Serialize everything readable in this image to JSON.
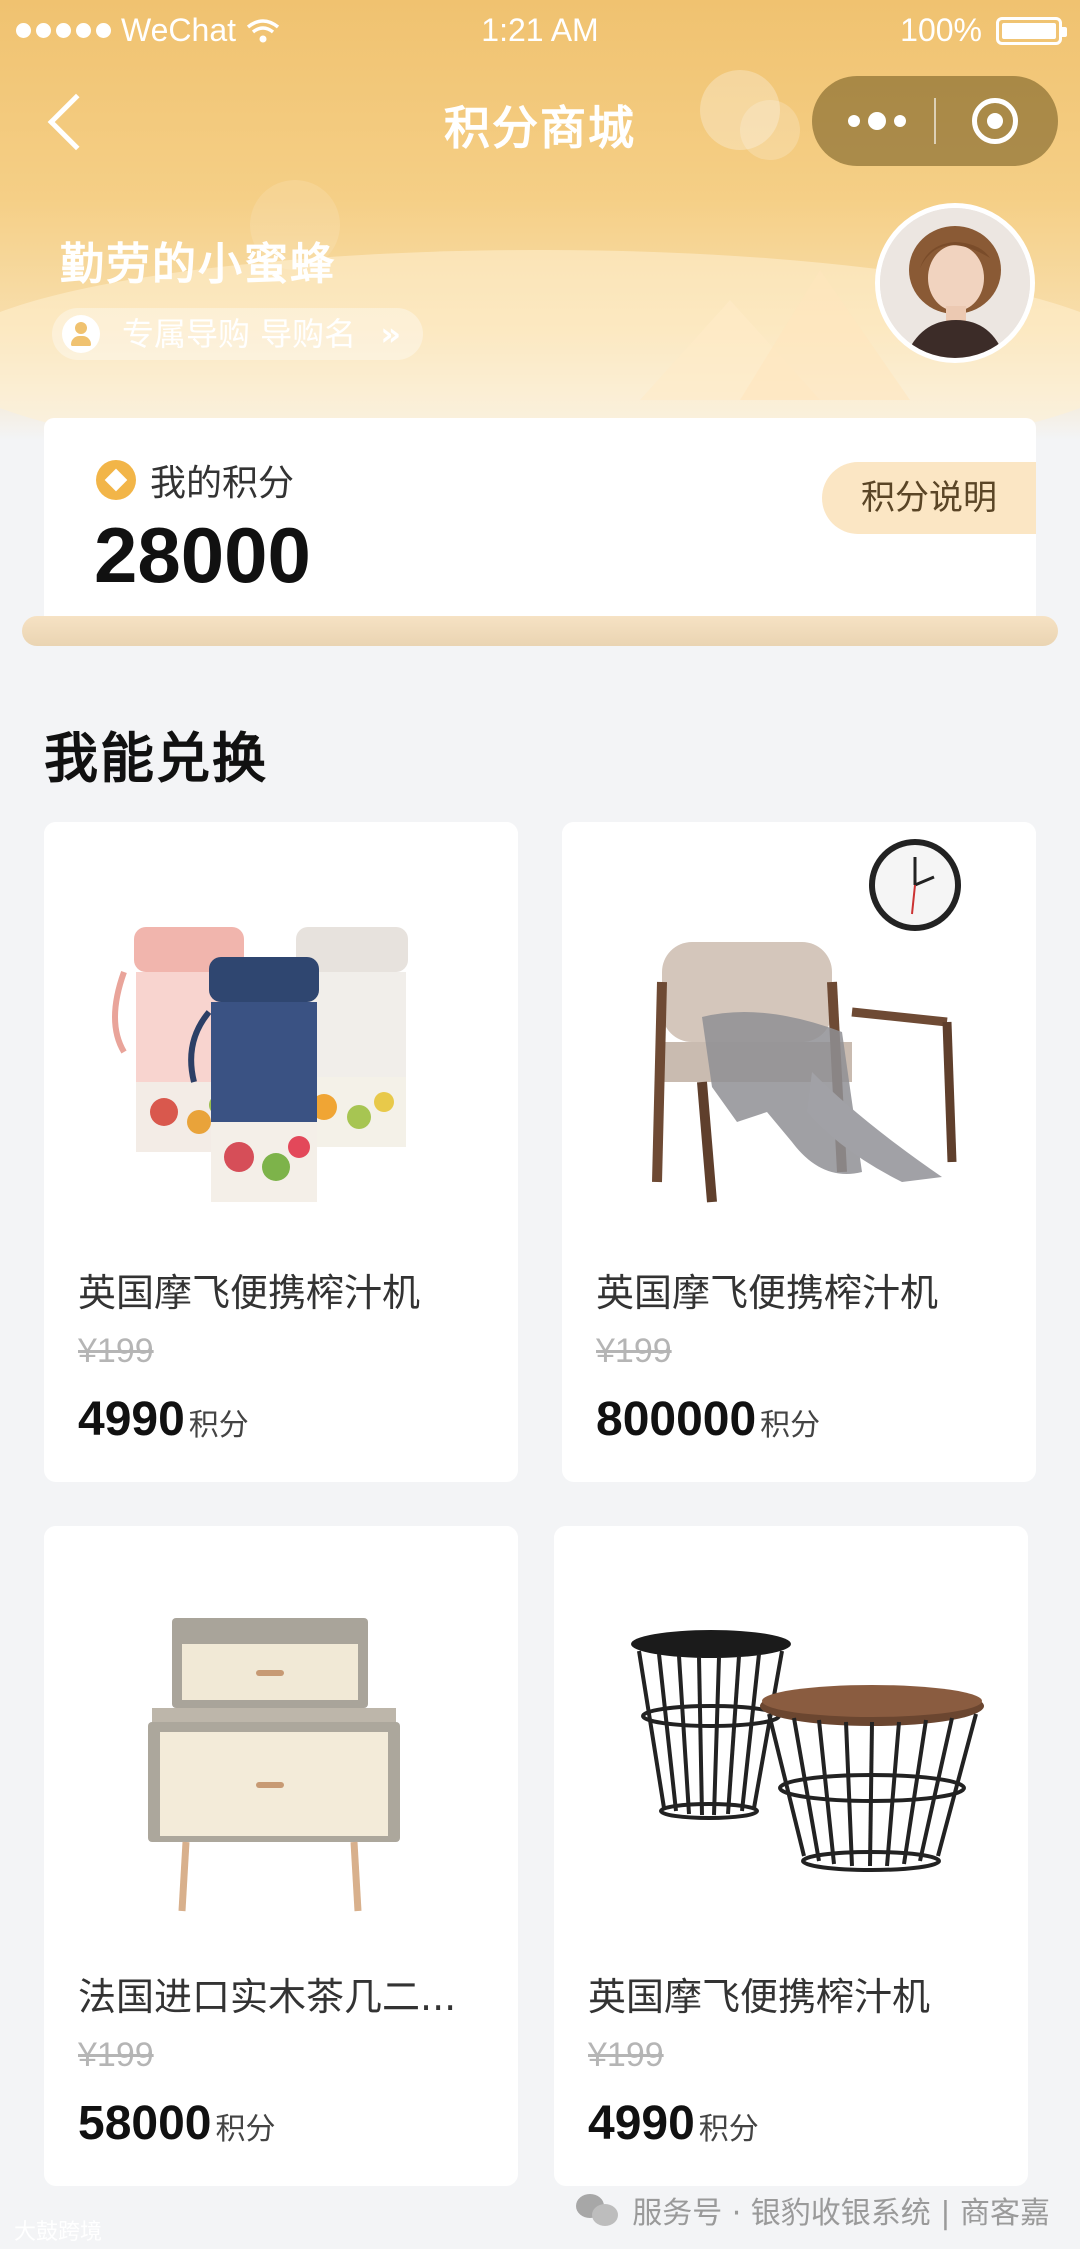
{
  "status_bar": {
    "carrier": "WeChat",
    "time": "1:21 AM",
    "battery": "100%"
  },
  "nav": {
    "title": "积分商城"
  },
  "user": {
    "name": "勤劳的小蜜蜂",
    "guide_label": "专属导购 导购名",
    "guide_arrow": "»"
  },
  "points": {
    "label": "我的积分",
    "value": "28000",
    "help_button": "积分说明"
  },
  "section": {
    "title": "我能兑换"
  },
  "products": [
    {
      "name": "英国摩飞便携榨汁机",
      "original_price": "¥199",
      "points": "4990",
      "unit": "积分",
      "image": "portable-blenders"
    },
    {
      "name": "英国摩飞便携榨汁机",
      "original_price": "¥199",
      "points": "800000",
      "unit": "积分",
      "image": "armchair-with-clock"
    },
    {
      "name": "法国进口实木茶几二...",
      "original_price": "¥199",
      "points": "58000",
      "unit": "积分",
      "image": "nightstand"
    },
    {
      "name": "英国摩飞便携榨汁机",
      "original_price": "¥199",
      "points": "4990",
      "unit": "积分",
      "image": "wire-side-tables"
    }
  ],
  "footer": {
    "watermark_left": "大鼓跨境",
    "watermark_right": "服务号 · 银豹收银系统 | 商客嘉"
  },
  "colors": {
    "header_gold": "#f0c270",
    "accent_pill": "#fbe6c4",
    "coin": "#f2b548"
  }
}
